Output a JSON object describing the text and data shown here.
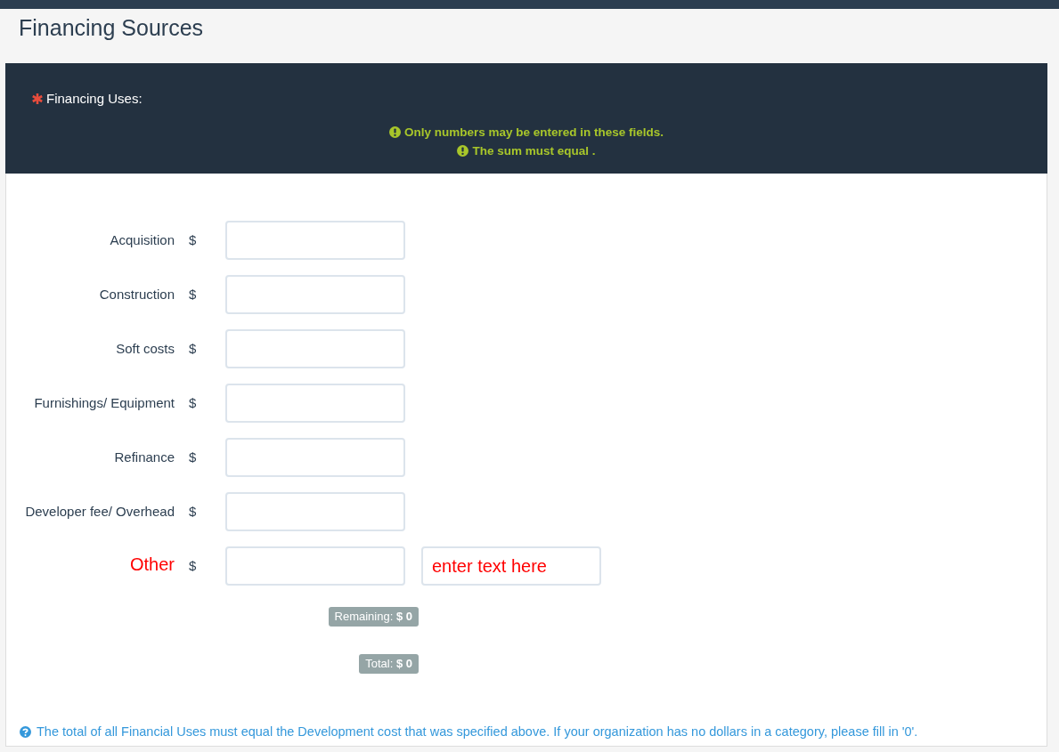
{
  "page": {
    "title": "Financing Sources"
  },
  "panel": {
    "heading": {
      "label": "Financing Uses:",
      "required": true
    },
    "warnings": [
      "Only numbers may be entered in these fields.",
      "The sum must equal ."
    ],
    "fields": [
      {
        "kind": "amount",
        "label": "Acquisition",
        "currency": "$"
      },
      {
        "kind": "amount",
        "label": "Construction",
        "currency": "$"
      },
      {
        "kind": "amount",
        "label": "Soft costs",
        "currency": "$"
      },
      {
        "kind": "amount",
        "label": "Furnishings/ Equipment",
        "currency": "$"
      },
      {
        "kind": "amount",
        "label": "Refinance",
        "currency": "$"
      },
      {
        "kind": "amount",
        "label": "Developer fee/ Overhead",
        "currency": "$"
      },
      {
        "kind": "other",
        "label": "Other",
        "currency": "$",
        "placeholder": "enter text here"
      }
    ],
    "remaining": "Remaining: **$ 0**",
    "total": "Total: **$ 0**",
    "help_note": "The total of all Financial Uses must equal the Development cost that was specified above. If your organization has no dollars in a category, please fill in '0'."
  }
}
